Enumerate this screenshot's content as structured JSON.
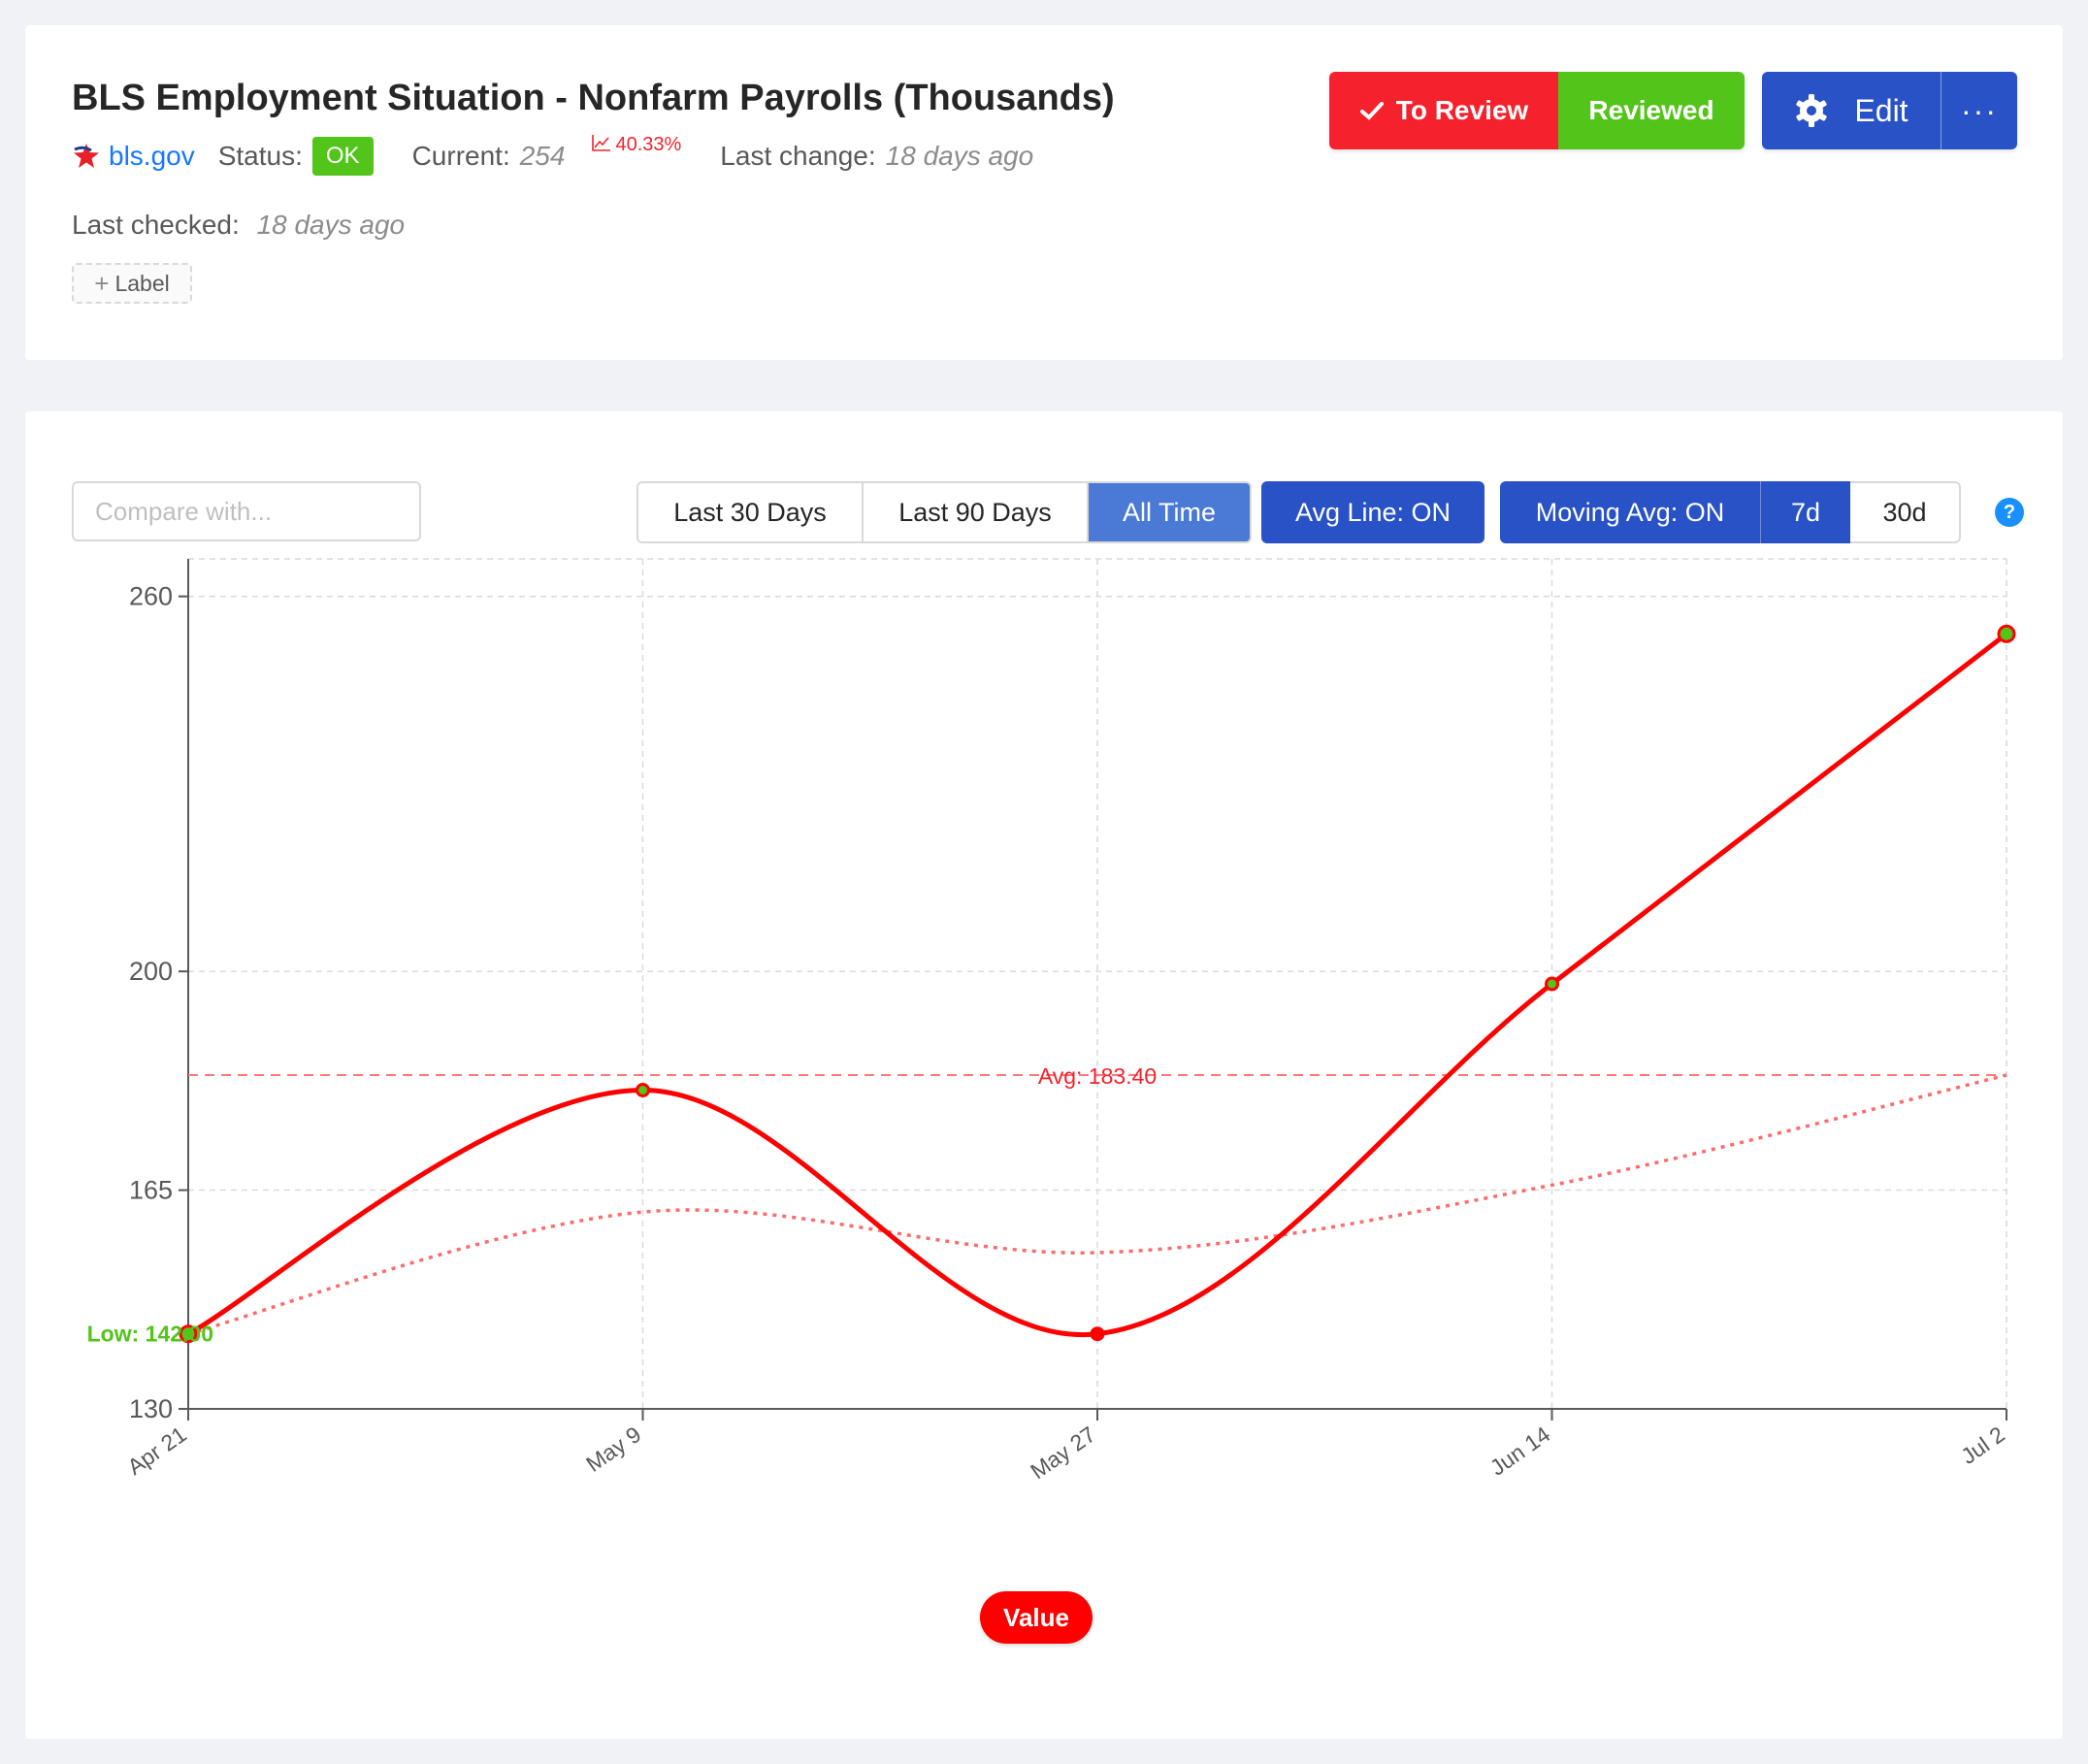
{
  "header": {
    "title": "BLS Employment Situation - Nonfarm Payrolls (Thousands)",
    "source_icon": "star-icon",
    "source": "bls.gov",
    "status_label": "Status:",
    "status": "OK",
    "current_label": "Current:",
    "current_value": "254",
    "change_icon": "trend-up-icon",
    "change_pct": "40.33%",
    "last_change_label": "Last change:",
    "last_change_value": "18 days ago",
    "last_checked_label": "Last checked:",
    "last_checked_value": "18 days ago",
    "add_label": "Label",
    "colors": {
      "ok": "#52c41a",
      "change": "#f5222d",
      "link": "#1677ff"
    }
  },
  "actions": {
    "to_review": "To Review",
    "reviewed": "Reviewed",
    "edit": "Edit",
    "edit_icon": "gear-icon",
    "more": "···",
    "colors": {
      "to_review": "#f5222d",
      "reviewed": "#52c41a",
      "edit": "#2852c6"
    }
  },
  "controls": {
    "compare_placeholder": "Compare with...",
    "ranges": [
      "Last 30 Days",
      "Last 90 Days",
      "All Time"
    ],
    "active_range": "All Time",
    "avg_line": "Avg Line: ON",
    "moving_avg": "Moving Avg: ON",
    "ma_windows": [
      "7d",
      "30d"
    ],
    "active_ma_window": "7d",
    "help": "?"
  },
  "chart_data": {
    "type": "line",
    "x": [
      "Apr 21",
      "May 9",
      "May 27",
      "Jun 14",
      "Jul 2"
    ],
    "yticks": [
      130,
      165,
      200,
      260
    ],
    "ylim": [
      130,
      266
    ],
    "grid": true,
    "series": [
      {
        "name": "Value",
        "values": [
          142,
          181,
          142,
          198,
          254
        ],
        "color": "#ff0000"
      }
    ],
    "moving_avg": {
      "values": [
        142,
        161.5,
        155,
        165.8,
        183.4
      ],
      "color": "#ff6b6b"
    },
    "avg_line": {
      "value": 183.4,
      "label": "Avg: 183.40",
      "color": "#ff7875"
    },
    "low_marker": {
      "label": "Low: 142.00",
      "value": 142,
      "color": "#52c41a"
    },
    "legend": [
      "Value"
    ],
    "legend_position": "bottom-center"
  }
}
